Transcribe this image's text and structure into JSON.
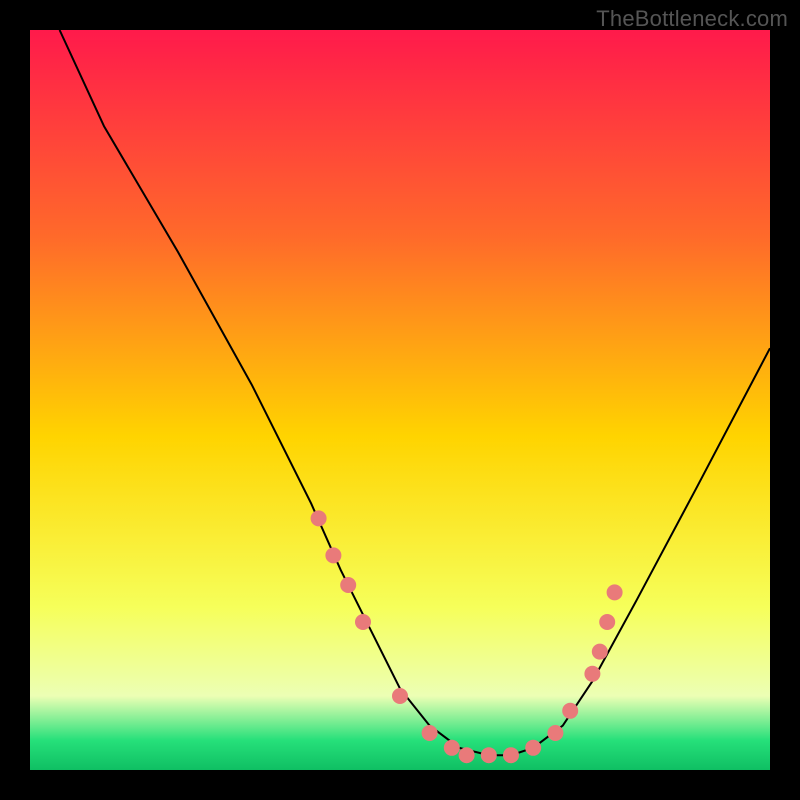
{
  "watermark": "TheBottleneck.com",
  "colors": {
    "background": "#000000",
    "gradient_top": "#ff1a4b",
    "gradient_mid_upper": "#ff6a2a",
    "gradient_mid": "#ffd400",
    "gradient_lower": "#f6ff5a",
    "gradient_pale": "#ecffb4",
    "gradient_green": "#26e07a",
    "gradient_bottom": "#0fbf63",
    "curve": "#000000",
    "dots": "#e97a7a"
  },
  "chart_data": {
    "type": "line",
    "title": "",
    "xlabel": "",
    "ylabel": "",
    "xlim": [
      0,
      100
    ],
    "ylim": [
      0,
      100
    ],
    "series": [
      {
        "name": "bottleneck-curve",
        "x": [
          4,
          10,
          20,
          30,
          38,
          42,
          46,
          50,
          54,
          58,
          62,
          65,
          68,
          72,
          76,
          82,
          90,
          100
        ],
        "y": [
          100,
          87,
          70,
          52,
          36,
          27,
          19,
          11,
          6,
          3,
          2,
          2,
          3,
          6,
          12,
          23,
          38,
          57
        ]
      }
    ],
    "markers": {
      "name": "highlight-dots",
      "x": [
        39,
        41,
        43,
        45,
        50,
        54,
        57,
        59,
        62,
        65,
        68,
        71,
        73,
        76,
        77,
        78,
        79
      ],
      "y": [
        34,
        29,
        25,
        20,
        10,
        5,
        3,
        2,
        2,
        2,
        3,
        5,
        8,
        13,
        16,
        20,
        24
      ]
    }
  }
}
